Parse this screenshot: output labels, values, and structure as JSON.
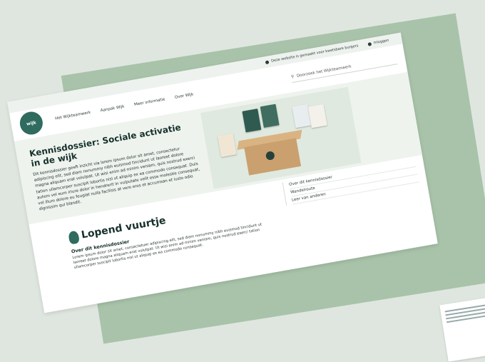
{
  "topbar": {
    "help_text": "Deze website is gemaakt voor kwetsbare burgers",
    "login_text": "Inloggen"
  },
  "logo": {
    "text": "wijk"
  },
  "nav": {
    "items": [
      "Het Wijkteamwerk",
      "Aanpak Wijk",
      "Meer informatie",
      "Over Wijk"
    ]
  },
  "search": {
    "placeholder": "Doorzoek het Wijkteamwerk"
  },
  "hero": {
    "title": "Kennisdossier: Sociale activatie in de wijk",
    "body": "Dit kennisdossier geeft inzicht via lorem ipsum dolor sit amet, consectetur adipiscing elit, sed diam nonummy nibh euismod tincidunt ut laoreet dolore magna aliquam erat volutpat. Ut wisi enim ad minim veniam, quis nostrud exerci tation ullamcorper suscipit lobortis nisl ut aliquip ex ea commodo consequat. Duis autem vel eum iriure dolor in hendrerit in vulputate velit esse molestie consequat, vel illum dolore eu feugiat nulla facilisis at vero eros et accumsan et iusto odio dignissim qui blandit."
  },
  "section": {
    "title": "Lopend vuurtje",
    "about_title": "Over dit kennisdossier",
    "about_body": "Lorem ipsum dolor sit amet, consectetuer adipiscing elit, sed diam nonummy nibh euismod tincidunt ut laoreet dolore magna aliquam erat volutpat. Ut wisi enim ad minim veniam, quis nostrud exerci tation ullamcorper suscipit lobortis nisl ut aliquip ex ea commodo consequat."
  },
  "sidebar": {
    "items": [
      "Over dit kennisdossier",
      "Wandelroute",
      "Leer van anderen"
    ]
  },
  "colors": {
    "background": "#dfe6df",
    "accent": "#2f6b5e",
    "shadow_card": "#a9c3aa"
  }
}
